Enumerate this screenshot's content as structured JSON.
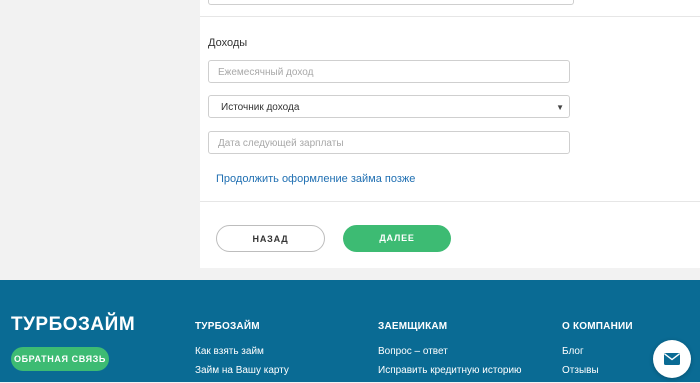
{
  "income": {
    "section_title": "Доходы",
    "monthly_income_placeholder": "Ежемесячный доход",
    "income_source_selected": "Источник дохода",
    "next_salary_placeholder": "Дата следующей зарплаты",
    "continue_later_link": "Продолжить оформление займа позже"
  },
  "nav": {
    "back_label": "НАЗАД",
    "next_label": "ДАЛЕЕ"
  },
  "footer": {
    "logo": "ТУРБОЗАЙМ",
    "feedback_label": "ОБРАТНАЯ СВЯЗЬ",
    "columns": [
      {
        "title": "ТУРБОЗАЙМ",
        "links": [
          "Как взять займ",
          "Займ на Вашу карту"
        ]
      },
      {
        "title": "ЗАЕМЩИКАМ",
        "links": [
          "Вопрос – ответ",
          "Исправить кредитную историю"
        ]
      },
      {
        "title": "О КОМПАНИИ",
        "links": [
          "Блог",
          "Отзывы"
        ]
      }
    ]
  },
  "colors": {
    "accent_green": "#3dbb73",
    "footer_blue": "#0a6b94",
    "link_blue": "#1f6fb2"
  },
  "icons": {
    "mail_button": "envelope-icon",
    "select_caret": "caret-down-icon"
  }
}
